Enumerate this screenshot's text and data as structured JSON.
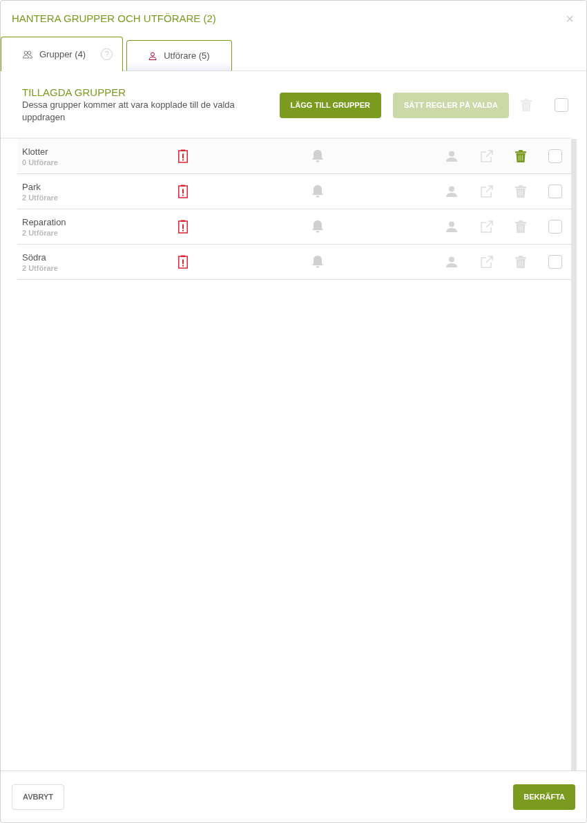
{
  "dialog": {
    "title": "HANTERA GRUPPER OCH UTFÖRARE (2)",
    "close": "×"
  },
  "tabs": [
    {
      "label": "Grupper (4)",
      "kind": "groups",
      "selected": true,
      "help": "?"
    },
    {
      "label": "Utförare (5)",
      "kind": "person",
      "selected": false
    }
  ],
  "section": {
    "title": "TILLAGDA GRUPPER",
    "subtitle": "Dessa grupper kommer att vara kopplade till de valda uppdragen",
    "buttons": [
      {
        "label": "LÄGG TILL GRUPPER",
        "disabled": false
      },
      {
        "label": "SÄTT REGLER PÅ VALDA",
        "disabled": true
      }
    ],
    "select_all": {
      "checked": false
    }
  },
  "rows": [
    {
      "name": "Klotter",
      "count": "0 Utförare",
      "hovered": true,
      "checked": false
    },
    {
      "name": "Park",
      "count": "2 Utförare",
      "hovered": false,
      "checked": false
    },
    {
      "name": "Reparation",
      "count": "2 Utförare",
      "hovered": false,
      "checked": false
    },
    {
      "name": "Södra",
      "count": "2 Utförare",
      "hovered": false,
      "checked": false
    }
  ],
  "footer": {
    "cancel": "AVBRYT",
    "confirm": "BEKRÄFTA"
  }
}
